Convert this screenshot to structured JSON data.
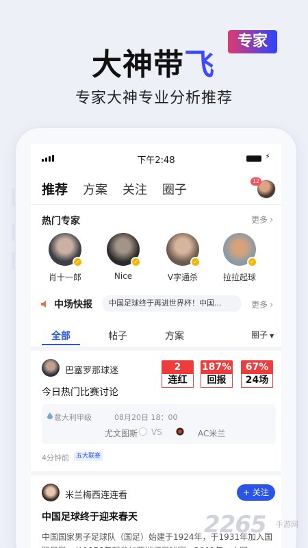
{
  "hero": {
    "title_main": "大神带",
    "title_accent": "飞",
    "badge": "专家",
    "subtitle": "专家大神专业分析推荐"
  },
  "status_bar": {
    "time": "下午2:48"
  },
  "top_tabs": [
    {
      "label": "推荐",
      "active": true
    },
    {
      "label": "方案",
      "active": false
    },
    {
      "label": "关注",
      "active": false
    },
    {
      "label": "圈子",
      "active": false
    }
  ],
  "user": {
    "notification_count": "12"
  },
  "hot_experts": {
    "title": "热门专家",
    "more": "更多",
    "items": [
      {
        "name": "肖十一郎",
        "verified": true
      },
      {
        "name": "Nice",
        "verified": true
      },
      {
        "name": "V字通杀",
        "verified": true
      },
      {
        "name": "拉拉起球",
        "verified": true
      }
    ]
  },
  "flash": {
    "title": "中场快报",
    "headline": "中国足球终于再进世界杯！中国...",
    "more": "更多"
  },
  "sub_tabs": [
    {
      "label": "全部",
      "active": true
    },
    {
      "label": "帖子",
      "active": false
    },
    {
      "label": "方案",
      "active": false
    }
  ],
  "filter": {
    "label": "圈子"
  },
  "post1": {
    "user": "巴塞罗那球迷",
    "title": "今日热门比赛讨论",
    "stats": [
      {
        "value": "2",
        "label": "连红"
      },
      {
        "value": "187%",
        "label": "回报"
      },
      {
        "value": "67%",
        "label": "24场"
      }
    ],
    "match": {
      "league": "意大利甲级",
      "date": "08月20日 18：00",
      "home": "尤文图斯",
      "vs": "VS",
      "away": "AC米兰"
    },
    "time_ago": "4分钟前",
    "tag": "五大联赛"
  },
  "post2": {
    "user": "米兰梅西连连看",
    "follow": "+ 关注",
    "title": "中国足球终于迎来春天",
    "body": "中国国家男子足球队（国足）始建于1924年，于1931年加入国际足联，从1976年起参加亚洲杯足球赛，2001年，中国"
  },
  "watermark": {
    "brand": "2265",
    "site": "手游网"
  },
  "colors": {
    "accent_blue": "#2a55e8",
    "stat_red": "#ef3b3b",
    "hero_accent": "#3b4bff"
  }
}
